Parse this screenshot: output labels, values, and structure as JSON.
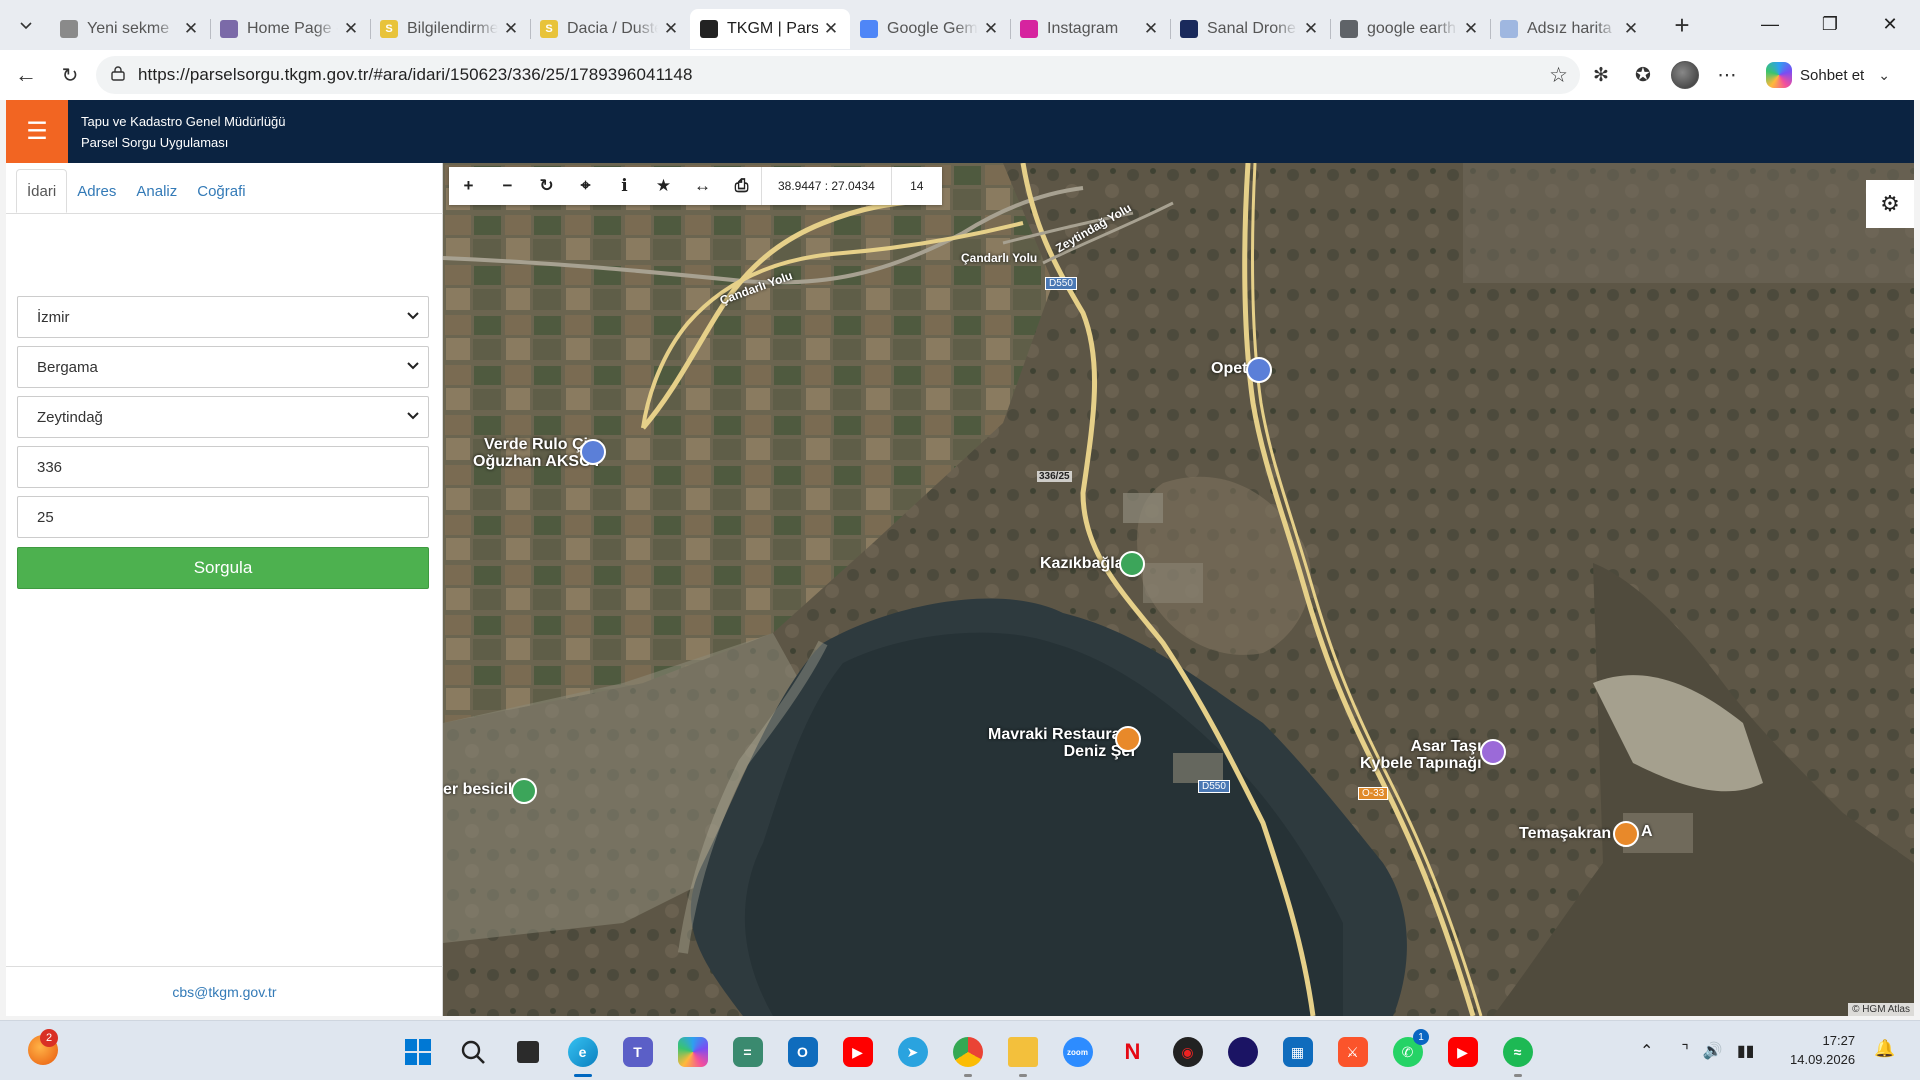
{
  "browser": {
    "tabs": [
      {
        "title": "Yeni sekme",
        "favicon": "new-tab-page",
        "color": "#8a8a8a",
        "glyph": ""
      },
      {
        "title": "Home Page -",
        "favicon": "home-page",
        "color": "#7b6aa8",
        "glyph": ""
      },
      {
        "title": "Bilgilendirme",
        "favicon": "s-letter",
        "color": "#e8c33a",
        "glyph": "S"
      },
      {
        "title": "Dacia / Duste",
        "favicon": "s-letter",
        "color": "#e8c33a",
        "glyph": "S"
      },
      {
        "title": "TKGM | Parse",
        "favicon": "map-pin",
        "color": "#222222",
        "glyph": "",
        "active": true
      },
      {
        "title": "Google Gemi",
        "favicon": "gemini-sparkle",
        "color": "#4f86f7",
        "glyph": ""
      },
      {
        "title": "Instagram",
        "favicon": "instagram",
        "color": "#d6249f",
        "glyph": ""
      },
      {
        "title": "Sanal Drone -",
        "favicon": "drone",
        "color": "#1a2a5c",
        "glyph": ""
      },
      {
        "title": "google earth",
        "favicon": "search",
        "color": "#5f6368",
        "glyph": ""
      },
      {
        "title": "Adsız harita",
        "favicon": "maps",
        "color": "#9fb7e0",
        "glyph": ""
      }
    ],
    "url": "https://parselsorgu.tkgm.gov.tr/#ara/idari/150623/336/25/1789396041148",
    "copilot_label": "Sohbet et"
  },
  "app": {
    "title_line1": "Tapu ve Kadastro Genel Müdürlüğü",
    "title_line2": "Parsel Sorgu Uygulaması",
    "brand_color": "#f26522",
    "header_color": "#0b2341"
  },
  "sidebar": {
    "tabs": [
      "İdari",
      "Adres",
      "Analiz",
      "Coğrafi"
    ],
    "active_tab": "İdari",
    "province": "İzmir",
    "district": "Bergama",
    "neighborhood": "Zeytindağ",
    "block": "336",
    "parcel": "25",
    "query_button": "Sorgula",
    "footer_email": "cbs@tkgm.gov.tr"
  },
  "map": {
    "coordinates": "38.9447 : 27.0434",
    "zoom": "14",
    "attribution": "© HGM Atlas",
    "labels": {
      "candarli_yolu_1": "Çandarlı Yolu",
      "candarli_yolu_2": "Çandarlı Yolu",
      "zeytindag_yolu": "Zeytindağ Yolu",
      "road_d550_top": "D550",
      "road_d550_bottom": "D550",
      "road_o33": "O-33",
      "opet": "Opet",
      "verde_line1": "Verde Rulo Çim",
      "verde_line2": "Oğuzhan AKSOY",
      "parcel": "336/25",
      "kazikbaglari": "Kazıkbağları",
      "mavraki_line1": "Mavraki Restaurant",
      "mavraki_line2": "Deniz Şef",
      "asar_line1": "Asar Taşı",
      "asar_line2": "Kybele Tapınağı",
      "besicilik": "er besicilik",
      "temasakran": "Temaşakran",
      "edge_a": "A"
    }
  },
  "taskbar": {
    "notification_count": "2",
    "whatsapp_count": "1",
    "time": "17:27",
    "date": "14.09.2026"
  }
}
